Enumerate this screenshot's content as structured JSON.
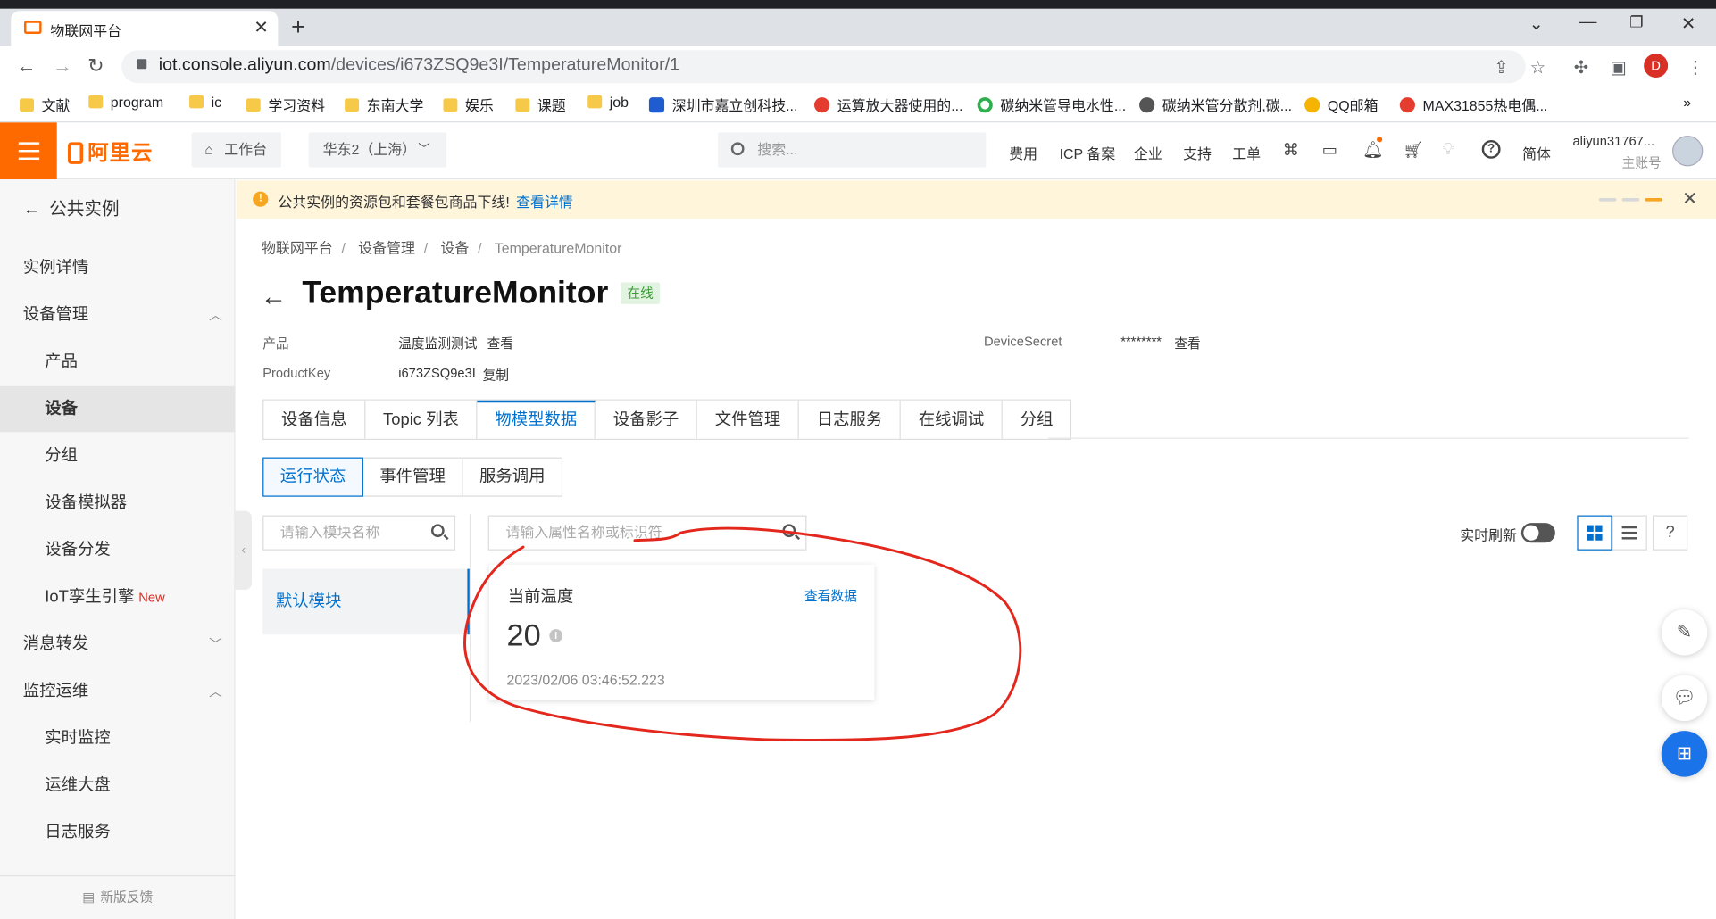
{
  "browser": {
    "tab_title": "物联网平台",
    "url_host": "iot.console.aliyun.com",
    "url_path": "/devices/i673ZSQ9e3I/TemperatureMonitor/1",
    "profile_initial": "D",
    "bookmarks": [
      "文献",
      "program",
      "ic",
      "学习资料",
      "东南大学",
      "娱乐",
      "课题",
      "job",
      "深圳市嘉立创科技...",
      "运算放大器使用的...",
      "碳纳米管导电水性...",
      "碳纳米管分散剂,碳...",
      "QQ邮箱",
      "MAX31855热电偶..."
    ],
    "bookmark_more": "»"
  },
  "header": {
    "logo": "阿里云",
    "workbench": "工作台",
    "region": "华东2（上海）",
    "search_placeholder": "搜索...",
    "links": [
      "费用",
      "ICP 备案",
      "企业",
      "支持",
      "工单"
    ],
    "lang": "简体",
    "username": "aliyun31767...",
    "account_type": "主账号"
  },
  "sidebar": {
    "back": "公共实例",
    "items": [
      "实例详情",
      "设备管理",
      "产品",
      "设备",
      "分组",
      "设备模拟器",
      "设备分发",
      "IoT孪生引擎",
      "消息转发",
      "监控运维",
      "实时监控",
      "运维大盘",
      "日志服务"
    ],
    "new_tag": "New",
    "feedback": "新版反馈"
  },
  "notice": {
    "text": "公共实例的资源包和套餐包商品下线!",
    "link": "查看详情"
  },
  "breadcrumb": [
    "物联网平台",
    "设备管理",
    "设备",
    "TemperatureMonitor"
  ],
  "device": {
    "name": "TemperatureMonitor",
    "status": "在线",
    "product_label": "产品",
    "product_value": "温度监测测试",
    "product_link": "查看",
    "productkey_label": "ProductKey",
    "productkey_value": "i673ZSQ9e3I",
    "productkey_link": "复制",
    "secret_label": "DeviceSecret",
    "secret_value": "********",
    "secret_link": "查看"
  },
  "tabs": [
    "设备信息",
    "Topic 列表",
    "物模型数据",
    "设备影子",
    "文件管理",
    "日志服务",
    "在线调试",
    "分组"
  ],
  "active_tab": "物模型数据",
  "subtabs": [
    "运行状态",
    "事件管理",
    "服务调用"
  ],
  "module_search_placeholder": "请输入模块名称",
  "module_selected": "默认模块",
  "prop_search_placeholder": "请输入属性名称或标识符",
  "realtime_label": "实时刷新",
  "help_label": "?",
  "card": {
    "name": "当前温度",
    "link": "查看数据",
    "value": "20",
    "time": "2023/02/06 03:46:52.223"
  },
  "colors": {
    "accent": "#ff6a00",
    "link": "#0070cc",
    "annotation": "#e3271d"
  }
}
